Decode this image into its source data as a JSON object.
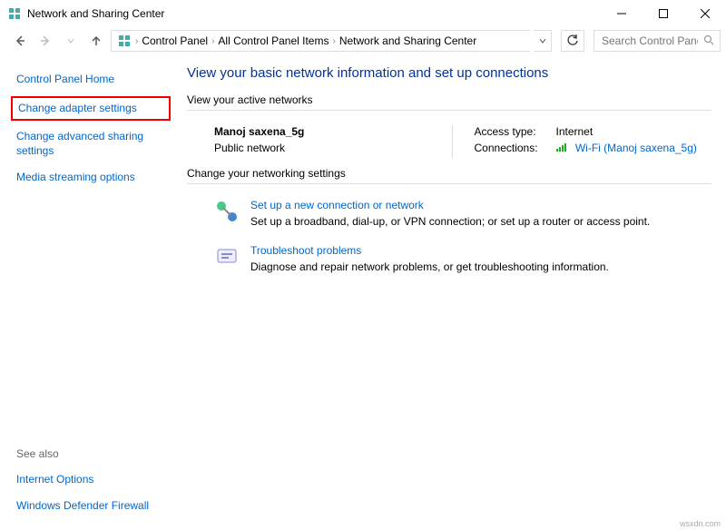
{
  "window": {
    "title": "Network and Sharing Center"
  },
  "breadcrumbs": {
    "items": [
      "Control Panel",
      "All Control Panel Items",
      "Network and Sharing Center"
    ]
  },
  "search": {
    "placeholder": "Search Control Panel"
  },
  "sidebar": {
    "home": "Control Panel Home",
    "adapter": "Change adapter settings",
    "advanced": "Change advanced sharing settings",
    "media": "Media streaming options",
    "seealso_title": "See also",
    "seealso_1": "Internet Options",
    "seealso_2": "Windows Defender Firewall"
  },
  "main": {
    "heading": "View your basic network information and set up connections",
    "active_label": "View your active networks",
    "network": {
      "name": "Manoj saxena_5g",
      "type": "Public network",
      "access_label": "Access type:",
      "access_value": "Internet",
      "conn_label": "Connections:",
      "conn_value": "Wi-Fi (Manoj saxena_5g)"
    },
    "change_label": "Change your networking settings",
    "setup": {
      "title": "Set up a new connection or network",
      "desc": "Set up a broadband, dial-up, or VPN connection; or set up a router or access point."
    },
    "troubleshoot": {
      "title": "Troubleshoot problems",
      "desc": "Diagnose and repair network problems, or get troubleshooting information."
    }
  },
  "watermark": "wsxdn.com"
}
